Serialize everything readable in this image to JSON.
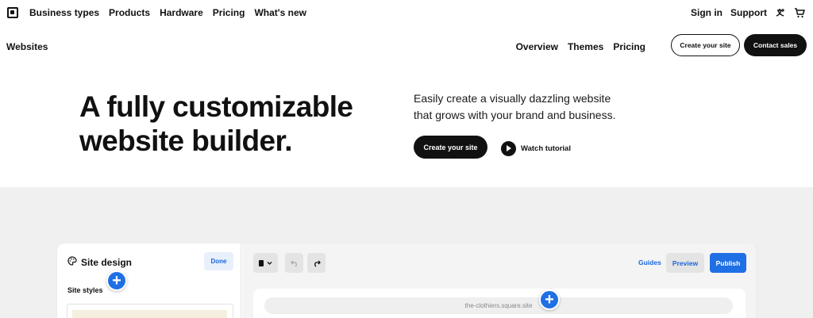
{
  "topnav": {
    "left_items": [
      "Business types",
      "Products",
      "Hardware",
      "Pricing",
      "What's new"
    ],
    "right_items": [
      "Sign in",
      "Support"
    ],
    "icons": [
      "square-logo-icon",
      "globe-language-icon",
      "cart-icon"
    ]
  },
  "subnav": {
    "title": "Websites",
    "links": [
      "Overview",
      "Themes",
      "Pricing"
    ],
    "create_label": "Create your site",
    "contact_label": "Contact sales"
  },
  "hero": {
    "title_line1": "A fully customizable",
    "title_line2": "website builder.",
    "subtitle": "Easily create a visually dazzling website that grows with your brand and business.",
    "cta_label": "Create your site",
    "watch_label": "Watch tutorial"
  },
  "app_preview": {
    "panel_title": "Site design",
    "done_label": "Done",
    "styles_label": "Site styles",
    "guides_label": "Guides",
    "preview_label": "Preview",
    "publish_label": "Publish",
    "url": "the-clothiers.square.site"
  },
  "colors": {
    "accent_blue": "#1f6fe5",
    "dark": "#111111",
    "gray_bg": "#f0f0f0"
  }
}
